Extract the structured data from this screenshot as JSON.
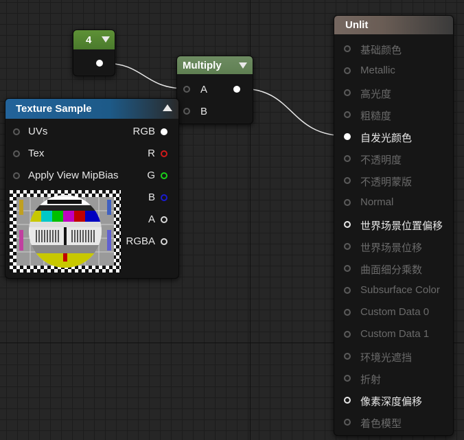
{
  "constant_node": {
    "title": "4"
  },
  "multiply_node": {
    "title": "Multiply",
    "inputs": [
      "A",
      "B"
    ]
  },
  "texture_node": {
    "title": "Texture Sample",
    "inputs": [
      "UVs",
      "Tex",
      "Apply View MipBias"
    ],
    "outputs": [
      "RGB",
      "R",
      "G",
      "B",
      "A",
      "RGBA"
    ],
    "output_colors": [
      "#ffffff",
      "#d21a1a",
      "#1ad21a",
      "#1a1ad2",
      "#d8d8d8",
      "#d8d8d8"
    ]
  },
  "unlit_node": {
    "title": "Unlit",
    "pins": [
      {
        "label": "基础颜色",
        "active": false
      },
      {
        "label": "Metallic",
        "active": false
      },
      {
        "label": "高光度",
        "active": false
      },
      {
        "label": "粗糙度",
        "active": false
      },
      {
        "label": "自发光颜色",
        "active": true,
        "connected": true
      },
      {
        "label": "不透明度",
        "active": false
      },
      {
        "label": "不透明蒙版",
        "active": false
      },
      {
        "label": "Normal",
        "active": false
      },
      {
        "label": "世界场景位置偏移",
        "active": true
      },
      {
        "label": "世界场景位移",
        "active": false
      },
      {
        "label": "曲面细分乘数",
        "active": false
      },
      {
        "label": "Subsurface Color",
        "active": false
      },
      {
        "label": "Custom Data 0",
        "active": false
      },
      {
        "label": "Custom Data 1",
        "active": false
      },
      {
        "label": "环境光遮挡",
        "active": false
      },
      {
        "label": "折射",
        "active": false
      },
      {
        "label": "像素深度偏移",
        "active": true
      },
      {
        "label": "着色模型",
        "active": false
      }
    ]
  },
  "colors": {
    "constant_header": "#4a7a2c",
    "multiply_header": "#5f7f52",
    "texture_header": "#1d5a88",
    "unlit_header": "#6a5d55"
  }
}
